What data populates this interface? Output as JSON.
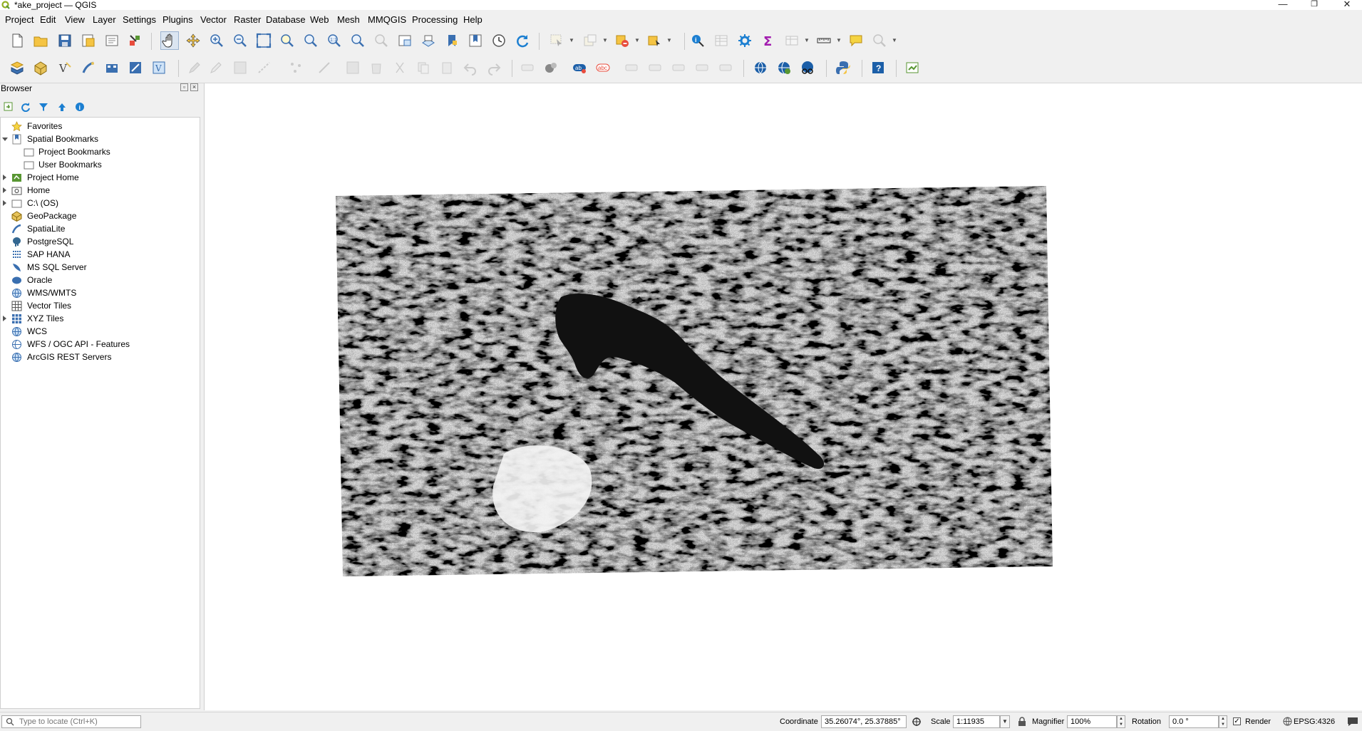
{
  "window": {
    "title": "*ake_project — QGIS",
    "minimize": "—",
    "restore": "❐",
    "close": "✕"
  },
  "menu": [
    {
      "label": "Project"
    },
    {
      "label": "Edit"
    },
    {
      "label": "View"
    },
    {
      "label": "Layer"
    },
    {
      "label": "Settings"
    },
    {
      "label": "Plugins"
    },
    {
      "label": "Vector"
    },
    {
      "label": "Raster"
    },
    {
      "label": "Database"
    },
    {
      "label": "Web"
    },
    {
      "label": "Mesh"
    },
    {
      "label": "MMQGIS"
    },
    {
      "label": "Processing"
    },
    {
      "label": "Help"
    }
  ],
  "browser": {
    "title": "Browser",
    "tree": [
      {
        "label": "Favorites",
        "icon": "star-icon"
      },
      {
        "label": "Spatial Bookmarks",
        "icon": "bookmarks-icon",
        "expanded": true
      },
      {
        "label": "Project Bookmarks",
        "icon": "folder-icon"
      },
      {
        "label": "User Bookmarks",
        "icon": "folder-icon"
      },
      {
        "label": "Project Home",
        "icon": "project-home-icon",
        "expandable": true
      },
      {
        "label": "Home",
        "icon": "home-folder-icon",
        "expandable": true
      },
      {
        "label": "C:\\ (OS)",
        "icon": "drive-icon",
        "expandable": true
      },
      {
        "label": "GeoPackage",
        "icon": "geopackage-icon"
      },
      {
        "label": "SpatiaLite",
        "icon": "spatialite-icon"
      },
      {
        "label": "PostgreSQL",
        "icon": "postgresql-icon"
      },
      {
        "label": "SAP HANA",
        "icon": "sap-hana-icon"
      },
      {
        "label": "MS SQL Server",
        "icon": "mssql-icon"
      },
      {
        "label": "Oracle",
        "icon": "oracle-icon"
      },
      {
        "label": "WMS/WMTS",
        "icon": "wms-icon"
      },
      {
        "label": "Vector Tiles",
        "icon": "vector-tiles-icon"
      },
      {
        "label": "XYZ Tiles",
        "icon": "xyz-tiles-icon",
        "expandable": true
      },
      {
        "label": "WCS",
        "icon": "wcs-icon"
      },
      {
        "label": "WFS / OGC API - Features",
        "icon": "wfs-icon"
      },
      {
        "label": "ArcGIS REST Servers",
        "icon": "arcgis-icon"
      }
    ]
  },
  "statusbar": {
    "locator_placeholder": "Type to locate (Ctrl+K)",
    "coordinate_label": "Coordinate",
    "coordinate_value": "35.26074°, 25.37885°",
    "scale_label": "Scale",
    "scale_value": "1:11935",
    "magnifier_label": "Magnifier",
    "magnifier_value": "100%",
    "rotation_label": "Rotation",
    "rotation_value": "0.0 °",
    "render_label": "Render",
    "crs": "EPSG:4326"
  },
  "colors": {
    "accent": "#589632",
    "chrome": "#f0f0f0",
    "canvas": "#ffffff"
  }
}
